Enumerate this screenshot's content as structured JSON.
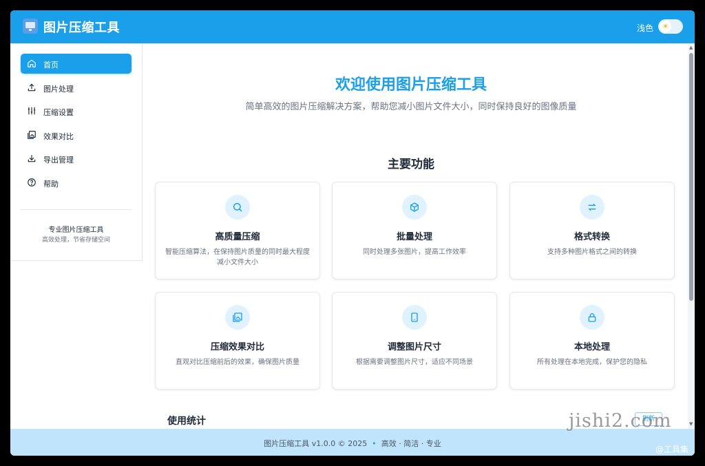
{
  "header": {
    "title": "图片压缩工具",
    "theme_label": "浅色",
    "theme_icon": "sun-icon"
  },
  "sidebar": {
    "items": [
      {
        "label": "首页",
        "icon": "home-icon",
        "active": true
      },
      {
        "label": "图片处理",
        "icon": "upload-icon",
        "active": false
      },
      {
        "label": "压缩设置",
        "icon": "sliders-icon",
        "active": false
      },
      {
        "label": "效果对比",
        "icon": "images-icon",
        "active": false
      },
      {
        "label": "导出管理",
        "icon": "download-icon",
        "active": false
      },
      {
        "label": "帮助",
        "icon": "help-icon",
        "active": false
      }
    ],
    "footer_title": "专业图片压缩工具",
    "footer_subtitle": "高效处理，节省存储空间"
  },
  "main": {
    "hero_title": "欢迎使用图片压缩工具",
    "hero_subtitle": "简单高效的图片压缩解决方案，帮助您减小图片文件大小，同时保持良好的图像质量",
    "features_title": "主要功能",
    "features": [
      {
        "title": "高质量压缩",
        "desc": "智能压缩算法，在保持图片质量的同时最大程度减小文件大小",
        "icon": "search-icon"
      },
      {
        "title": "批量处理",
        "desc": "同时处理多张图片，提高工作效率",
        "icon": "box-icon"
      },
      {
        "title": "格式转换",
        "desc": "支持多种图片格式之间的转换",
        "icon": "convert-icon"
      },
      {
        "title": "压缩效果对比",
        "desc": "直观对比压缩前后的效果，确保图片质量",
        "icon": "image-compare-icon"
      },
      {
        "title": "调整图片尺寸",
        "desc": "根据需要调整图片尺寸，适应不同场景",
        "icon": "tablet-icon"
      },
      {
        "title": "本地处理",
        "desc": "所有处理在本地完成，保护您的隐私",
        "icon": "lock-icon"
      }
    ],
    "stats_title": "使用统计",
    "refresh_label": "刷新"
  },
  "footer": {
    "text": "图片压缩工具 v1.0.0 © 2025",
    "separator": "•",
    "tagline": "高效 · 简洁 · 专业"
  },
  "watermark": {
    "site": "jishi2.com",
    "tag": "@工具集"
  },
  "colors": {
    "accent": "#1a9fea",
    "footer_bg": "#bfe4fb"
  }
}
